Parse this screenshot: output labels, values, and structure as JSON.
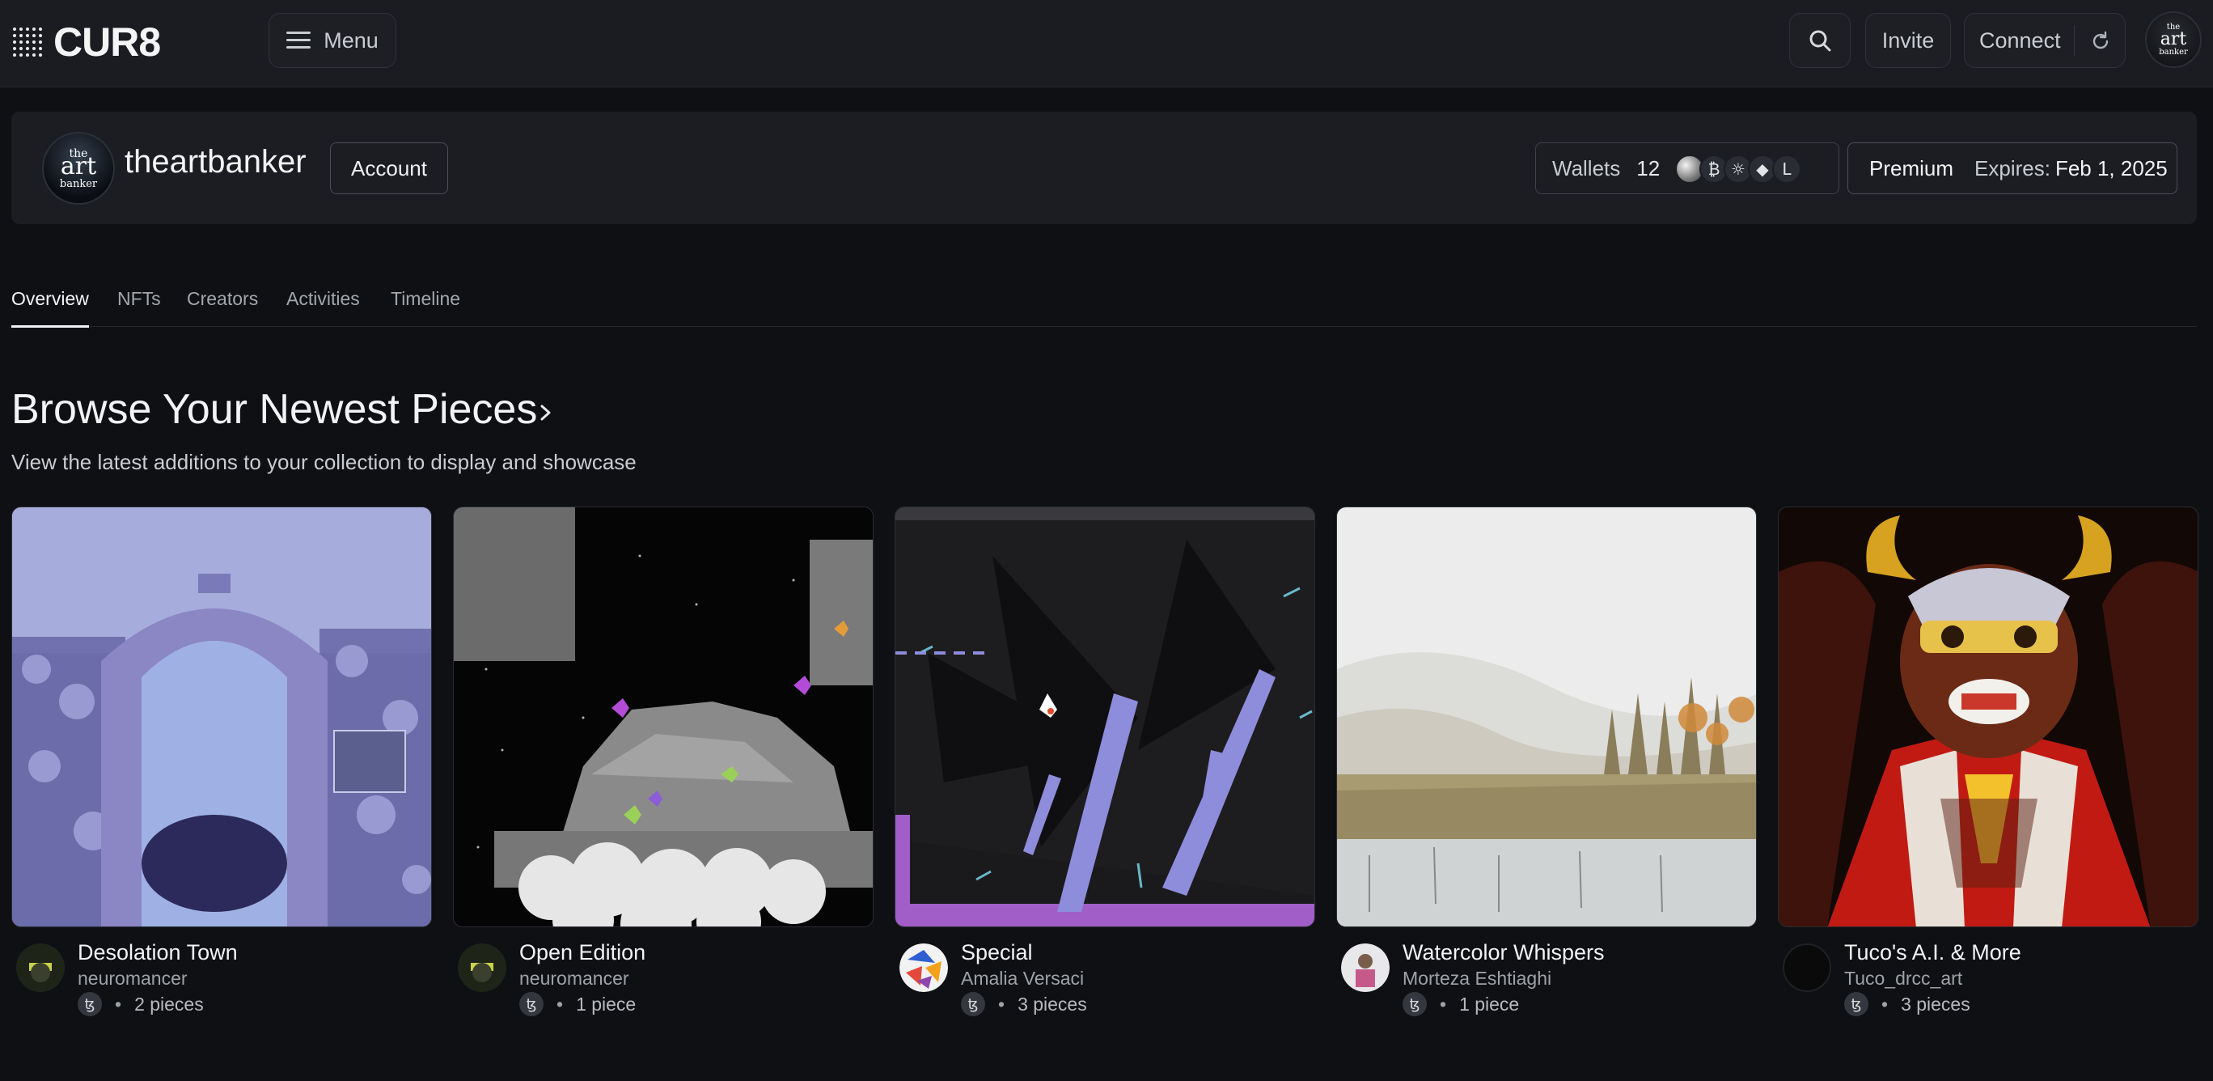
{
  "header": {
    "logo_text": "CUR8",
    "menu_label": "Menu",
    "invite_label": "Invite",
    "connect_label": "Connect",
    "icons": [
      "logo-dots-icon",
      "hamburger-icon",
      "search-icon",
      "refresh-icon",
      "avatar"
    ]
  },
  "profile": {
    "avatar_text": [
      "the",
      "art",
      "banker"
    ],
    "username": "theartbanker",
    "account_label": "Account",
    "wallets_label": "Wallets",
    "wallets_count": "12",
    "chain_icons": [
      "silver-coin-icon",
      "bitcoin-icon",
      "sun-chain-icon",
      "ethereum-icon",
      "l-chain-icon"
    ],
    "chain_glyphs": [
      "",
      "₿",
      "☼",
      "◆",
      "L"
    ],
    "plan": "Premium",
    "expires_label": "Expires:",
    "expires_date": "Feb 1, 2025"
  },
  "tabs": [
    {
      "label": "Overview",
      "active": true
    },
    {
      "label": "NFTs",
      "active": false
    },
    {
      "label": "Creators",
      "active": false
    },
    {
      "label": "Activities",
      "active": false
    },
    {
      "label": "Timeline",
      "active": false
    }
  ],
  "section": {
    "title": "Browse Your Newest Pieces",
    "subtitle": "View the latest additions to your collection to display and showcase"
  },
  "cards": [
    {
      "title": "Desolation Town",
      "creator": "neuromancer",
      "chain_glyph": "ꜩ",
      "count": "2 pieces"
    },
    {
      "title": "Open Edition",
      "creator": "neuromancer",
      "chain_glyph": "ꜩ",
      "count": "1 piece"
    },
    {
      "title": "Special",
      "creator": "Amalia Versaci",
      "chain_glyph": "ꜩ",
      "count": "3 pieces"
    },
    {
      "title": "Watercolor Whispers",
      "creator": "Morteza Eshtiaghi",
      "chain_glyph": "ꜩ",
      "count": "1 piece"
    },
    {
      "title": "Tuco's A.I. & More",
      "creator": "Tuco_drcc_art",
      "chain_glyph": "ꜩ",
      "count": "3 pieces"
    }
  ],
  "colors": {
    "background": "#0f1013",
    "topbar": "#1a1c21",
    "card": "#1b1d22",
    "text": "#f2f3f5",
    "muted": "#9ea2a9"
  }
}
